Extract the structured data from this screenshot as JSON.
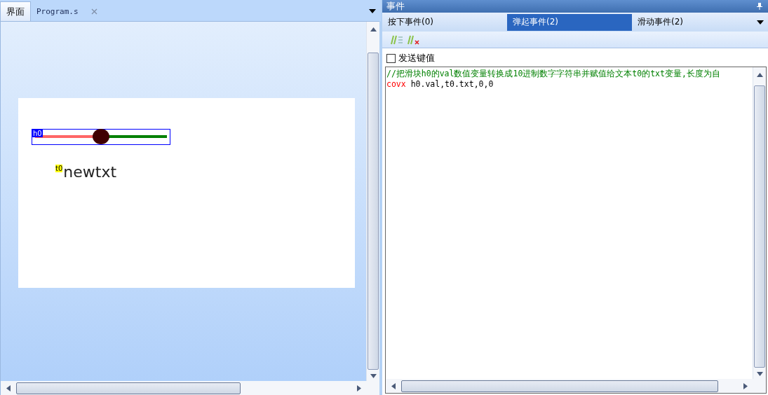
{
  "document_tabs": [
    {
      "label": "界面",
      "selected": true,
      "closable": false
    },
    {
      "label": "Program.s",
      "selected": false,
      "closable": true
    }
  ],
  "canvas": {
    "slider": {
      "name": "h0",
      "level": 0.5
    },
    "text": {
      "name": "t0",
      "value": "newtxt"
    }
  },
  "events_panel": {
    "title": "事件",
    "tabs": [
      {
        "label": "按下事件(0)",
        "selected": false
      },
      {
        "label": "弹起事件(2)",
        "selected": true
      },
      {
        "label": "滑动事件(2)",
        "selected": false
      }
    ],
    "send_key_value": {
      "label": "发送键值",
      "checked": false
    },
    "code_lines": [
      [
        {
          "kind": "comment",
          "text": "//把滑块h0的val数值变量转换成10进制数字字符串并赋值给文本t0的txt变量,长度为自"
        }
      ],
      [
        {
          "kind": "keyword",
          "text": "covx"
        },
        {
          "kind": "plain",
          "text": " h0.val,t0.txt,0,0"
        }
      ]
    ]
  }
}
